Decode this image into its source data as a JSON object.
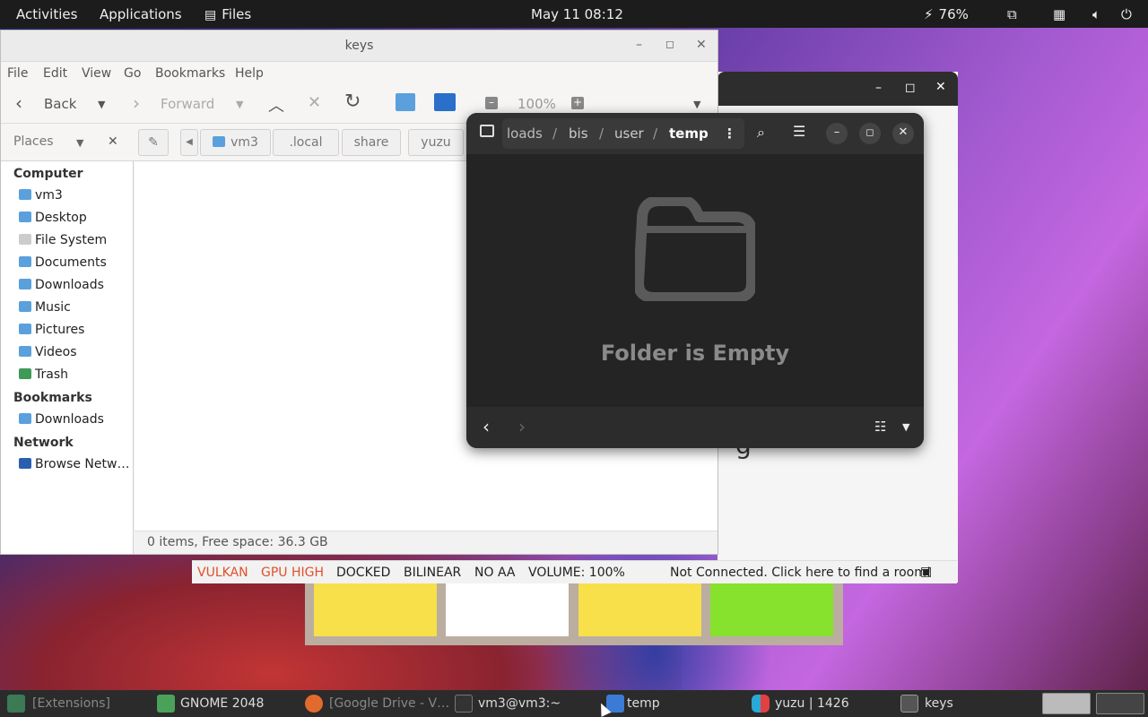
{
  "topbar": {
    "activities": "Activities",
    "applications": "Applications",
    "files_app": "Files",
    "clock": "May 11  08:12",
    "battery": "76%"
  },
  "caja": {
    "title": "keys",
    "menu": [
      "File",
      "Edit",
      "View",
      "Go",
      "Bookmarks",
      "Help"
    ],
    "toolbar": {
      "back": "Back",
      "forward": "Forward",
      "zoom": "100%"
    },
    "places_label": "Places",
    "path": [
      "vm3",
      ".local",
      "share",
      "yuzu"
    ],
    "sidebar": {
      "computer": "Computer",
      "computer_items": [
        "vm3",
        "Desktop",
        "File System",
        "Documents",
        "Downloads",
        "Music",
        "Pictures",
        "Videos",
        "Trash"
      ],
      "bookmarks": "Bookmarks",
      "bookmark_items": [
        "Downloads"
      ],
      "network": "Network",
      "network_items": [
        "Browse Netw…"
      ]
    },
    "status": "0 items, Free space: 36.3 GB"
  },
  "nautilus": {
    "path": [
      "loads",
      "bis",
      "user",
      "temp"
    ],
    "empty_text": "Folder is Empty"
  },
  "yuzu": {
    "status": [
      "VULKAN",
      "GPU HIGH",
      "DOCKED",
      "BILINEAR",
      "NO AA",
      "VOLUME: 100%"
    ],
    "room": "Not Connected. Click here to find a room!",
    "colors": {
      "vulkan": "#e0502a",
      "gpu": "#e0502a"
    }
  },
  "game2048": {
    "tile_colors": [
      "#f7e04a",
      "#ffffff",
      "#f7e04a",
      "#86e22c"
    ]
  },
  "taskbar": {
    "items": [
      "[Extensions]",
      "GNOME 2048",
      "[Google Drive - V…",
      "vm3@vm3:~",
      "temp",
      "yuzu | 1426",
      "keys"
    ]
  }
}
